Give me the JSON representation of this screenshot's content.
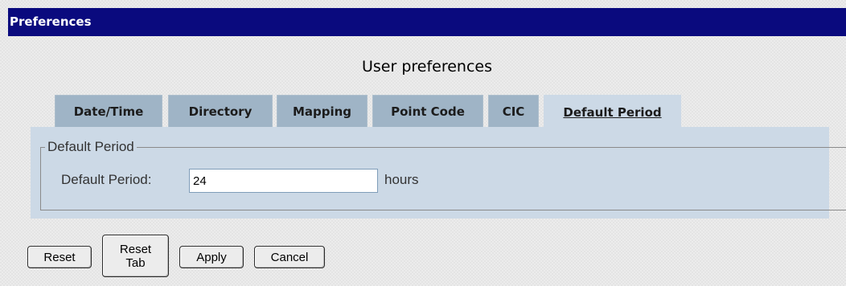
{
  "window": {
    "title": "Preferences"
  },
  "page": {
    "heading": "User preferences"
  },
  "tabs": [
    {
      "label": "Date/Time"
    },
    {
      "label": "Directory"
    },
    {
      "label": "Mapping"
    },
    {
      "label": "Point Code"
    },
    {
      "label": "CIC"
    },
    {
      "label": "Default Period",
      "active": true
    }
  ],
  "panel": {
    "legend": "Default Period",
    "field_label": "Default Period:",
    "field_value": "24",
    "unit": "hours"
  },
  "buttons": {
    "reset": "Reset",
    "reset_tab": "Reset\nTab",
    "apply": "Apply",
    "cancel": "Cancel"
  },
  "colors": {
    "titlebar": "#0a0a7e",
    "tab_inactive": "#9fb4c6",
    "tab_active": "#ccd9e6",
    "panel": "#ccd9e6"
  }
}
